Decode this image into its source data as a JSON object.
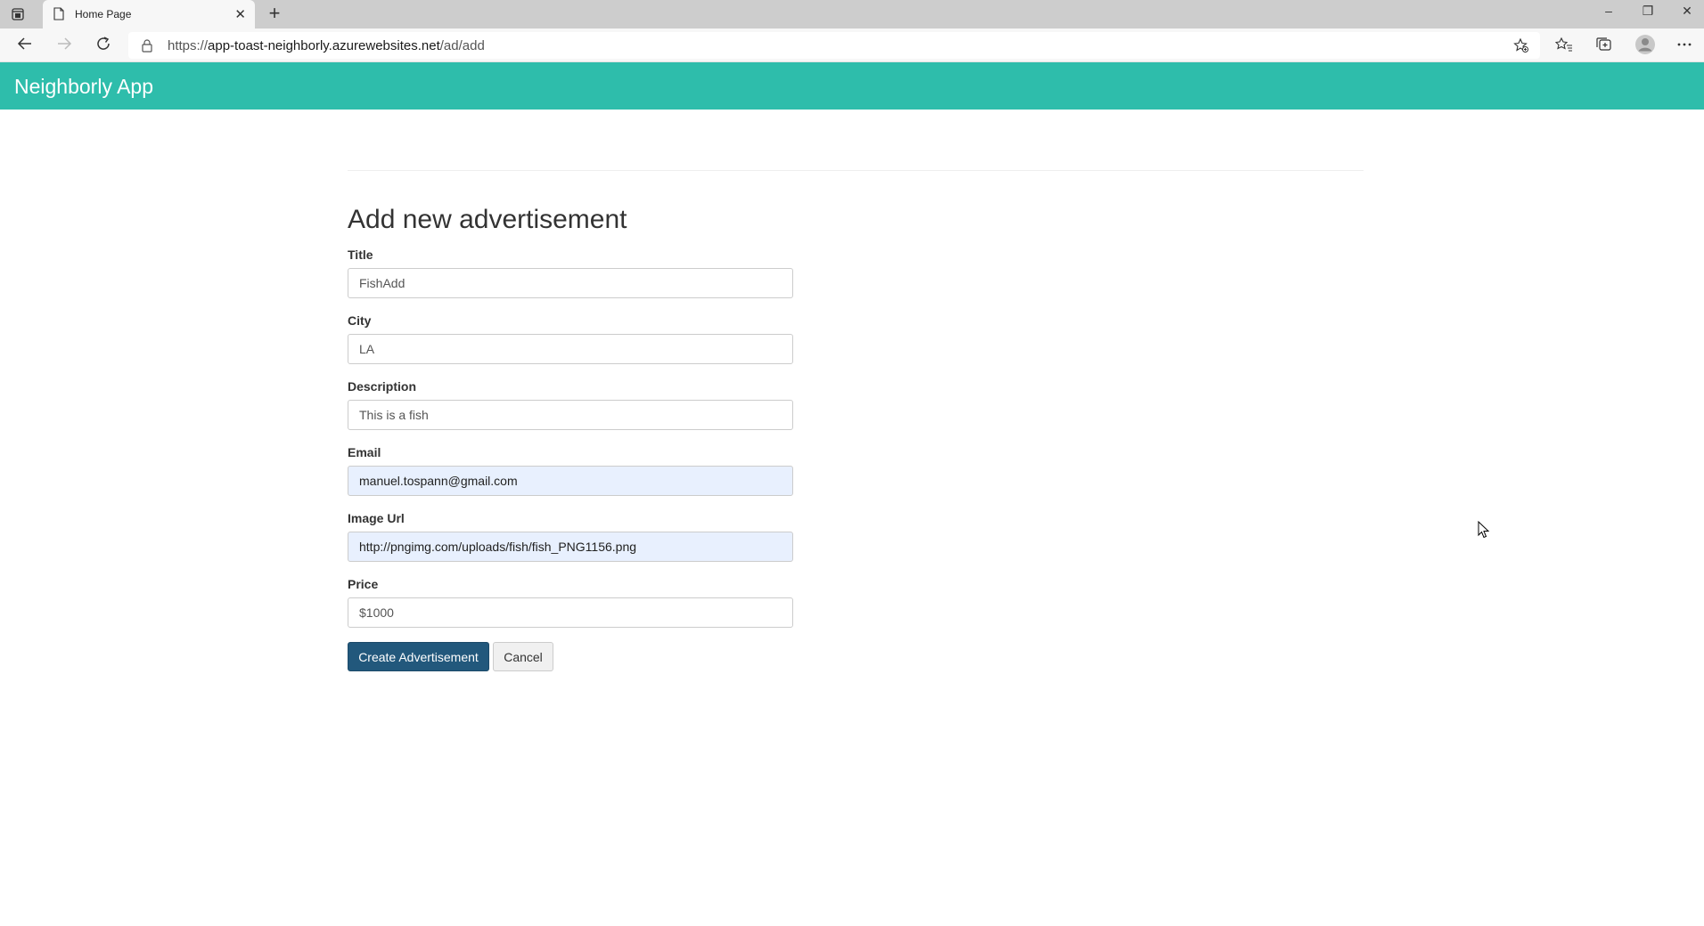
{
  "browser": {
    "tab_title": "Home Page",
    "new_tab_symbol": "+",
    "url_prefix": "https://",
    "url_host": "app-toast-neighborly.azurewebsites.net",
    "url_path": "/ad/add",
    "window_controls": {
      "minimize": "–",
      "restore": "❐",
      "close": "✕"
    }
  },
  "navbar": {
    "brand": "Neighborly App"
  },
  "page": {
    "title": "Add new advertisement"
  },
  "form": {
    "fields": [
      {
        "label": "Title",
        "value": "FishAdd"
      },
      {
        "label": "City",
        "value": "LA"
      },
      {
        "label": "Description",
        "value": "This is a fish"
      },
      {
        "label": "Email",
        "value": "manuel.tospann@gmail.com"
      },
      {
        "label": "Image Url",
        "value": "http://pngimg.com/uploads/fish/fish_PNG1156.png"
      },
      {
        "label": "Price",
        "value": "$1000"
      }
    ],
    "submit_label": "Create Advertisement",
    "cancel_label": "Cancel"
  },
  "colors": {
    "navbar": "#2ebdab",
    "primary_button": "#22587c",
    "autofill_bg": "#e8f0fe"
  },
  "icons": [
    "tab-actions-icon",
    "document-icon",
    "close-icon",
    "plus-icon",
    "back-arrow-icon",
    "forward-arrow-icon",
    "refresh-icon",
    "lock-icon",
    "favorite-add-icon",
    "favorites-icon",
    "collections-icon",
    "profile-icon",
    "more-icon",
    "cursor-icon"
  ]
}
